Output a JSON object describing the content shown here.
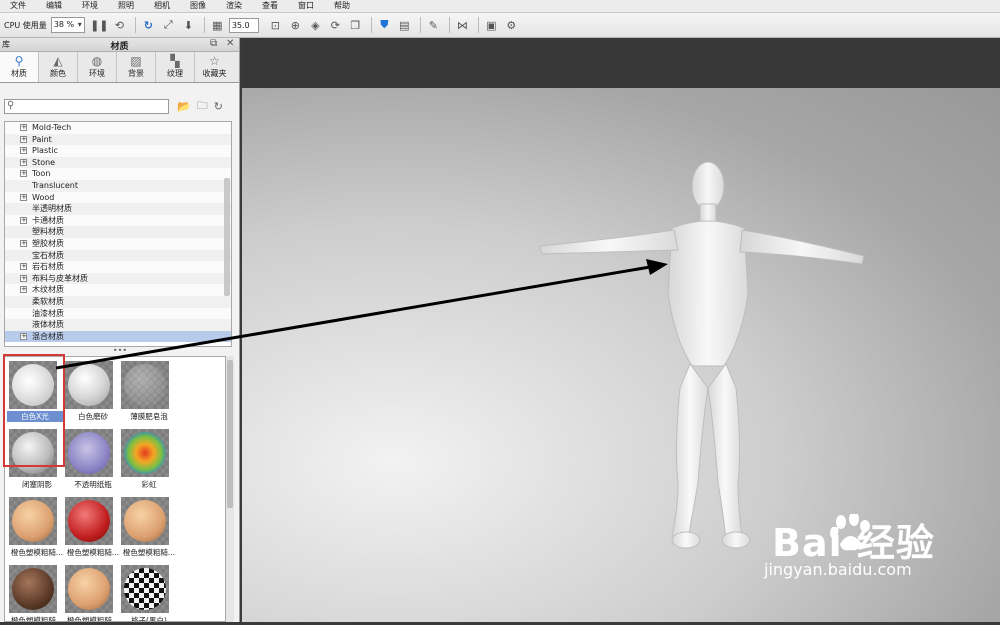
{
  "menu": [
    "文件",
    "编辑",
    "环境",
    "照明",
    "相机",
    "图像",
    "渲染",
    "查看",
    "窗口",
    "帮助"
  ],
  "toolbar": {
    "cpu_label": "CPU 使用量",
    "cpu_value": "38 %",
    "field_value": "35.0"
  },
  "panel": {
    "library_label": "库",
    "title": "材质",
    "tabs": [
      {
        "label": "材质",
        "icon": "material-icon"
      },
      {
        "label": "颜色",
        "icon": "color-icon"
      },
      {
        "label": "环境",
        "icon": "environment-icon"
      },
      {
        "label": "背景",
        "icon": "background-icon"
      },
      {
        "label": "纹理",
        "icon": "texture-icon"
      },
      {
        "label": "收藏夹",
        "icon": "favorites-icon"
      }
    ],
    "search": {
      "value": "",
      "placeholder": ""
    }
  },
  "tree": [
    {
      "label": "Mold-Tech",
      "expandable": true
    },
    {
      "label": "Paint",
      "expandable": true
    },
    {
      "label": "Plastic",
      "expandable": true
    },
    {
      "label": "Stone",
      "expandable": true
    },
    {
      "label": "Toon",
      "expandable": true
    },
    {
      "label": "Translucent",
      "expandable": false
    },
    {
      "label": "Wood",
      "expandable": true
    },
    {
      "label": "半透明材质",
      "expandable": false
    },
    {
      "label": "卡通材质",
      "expandable": true
    },
    {
      "label": "塑料材质",
      "expandable": false
    },
    {
      "label": "塑胶材质",
      "expandable": true
    },
    {
      "label": "宝石材质",
      "expandable": false
    },
    {
      "label": "岩石材质",
      "expandable": true
    },
    {
      "label": "布料与皮革材质",
      "expandable": true
    },
    {
      "label": "木纹材质",
      "expandable": true
    },
    {
      "label": "柔软材质",
      "expandable": false
    },
    {
      "label": "油漆材质",
      "expandable": false
    },
    {
      "label": "液体材质",
      "expandable": false
    },
    {
      "label": "混合材质",
      "expandable": true,
      "selected": true
    }
  ],
  "thumbnails": [
    {
      "caption": "白色X光",
      "selected": true
    },
    {
      "caption": "白色磨砂"
    },
    {
      "caption": "薄膜肥皂泡"
    },
    {
      "caption": "闭塞阴影"
    },
    {
      "caption": "不透明纸瓶"
    },
    {
      "caption": "彩虹"
    },
    {
      "caption": "橙色塑模粗糙..."
    },
    {
      "caption": "橙色塑模粗糙..."
    },
    {
      "caption": "橙色塑模粗糙..."
    },
    {
      "caption": "橙色塑模粗糙..."
    },
    {
      "caption": "橙色塑模粗糙..."
    },
    {
      "caption": "格子(黑白)"
    }
  ],
  "watermark": {
    "brand": "Bai  经验",
    "url": "jingyan.baidu.com"
  },
  "colors": {
    "selection_blue": "#6d8fd0",
    "highlight_red": "#d23a3a",
    "arrow": "#000000"
  }
}
